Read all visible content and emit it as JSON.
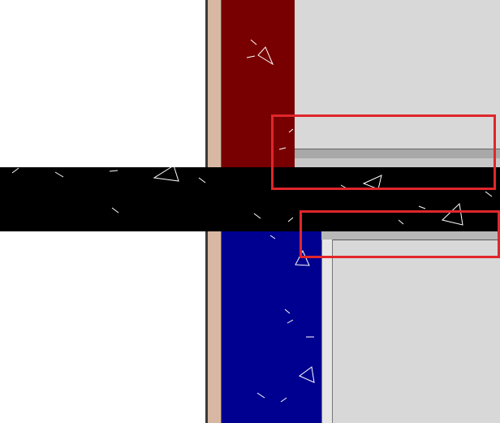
{
  "view": {
    "kind": "cad-section-detail",
    "background_color": "#ffffff"
  },
  "materials": {
    "finish_line_color": "#3a3a3a",
    "finish_strip_color": "#d8b8a3",
    "upper_insulation_color": "#780000",
    "lower_insulation_color": "#000090",
    "slab_color": "#000000",
    "interior_color": "#d8d8d8",
    "flashing_color": "#a8a8a8",
    "hatch_color": "#ffffff"
  },
  "annotations": {
    "highlight_color": "#e0262b",
    "highlight_count": 2
  }
}
